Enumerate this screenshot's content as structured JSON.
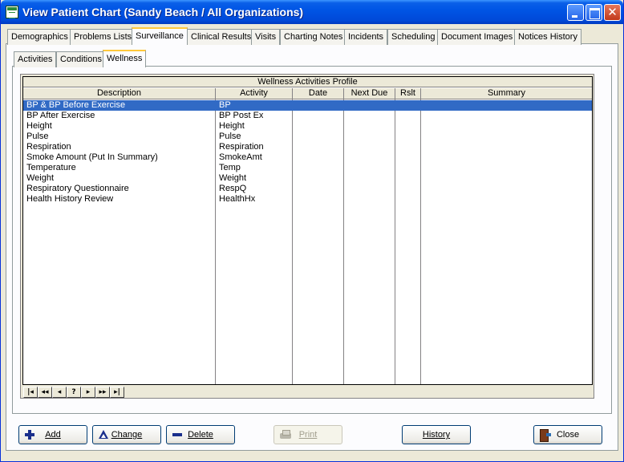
{
  "window": {
    "title": "View Patient Chart (Sandy Beach / All Organizations)",
    "close_glyph": "✕"
  },
  "main_tabs": [
    {
      "label": "Demographics"
    },
    {
      "label": "Problems Lists"
    },
    {
      "label": "Surveillance"
    },
    {
      "label": "Clinical Results"
    },
    {
      "label": "Visits"
    },
    {
      "label": "Charting Notes"
    },
    {
      "label": "Incidents"
    },
    {
      "label": "Scheduling"
    },
    {
      "label": "Document Images"
    },
    {
      "label": "Notices History"
    }
  ],
  "sub_tabs": [
    {
      "label": "Activities"
    },
    {
      "label": "Conditions"
    },
    {
      "label": "Wellness"
    }
  ],
  "grid": {
    "title": "Wellness Activities Profile",
    "columns": [
      "Description",
      "Activity",
      "Date",
      "Next Due",
      "Rslt",
      "Summary"
    ],
    "rows": [
      {
        "description": "BP & BP  Before Exercise",
        "activity": "BP",
        "date": "",
        "next_due": "",
        "rslt": "",
        "summary": ""
      },
      {
        "description": "BP After Exercise",
        "activity": "BP Post Ex",
        "date": "",
        "next_due": "",
        "rslt": "",
        "summary": ""
      },
      {
        "description": "Height",
        "activity": "Height",
        "date": "",
        "next_due": "",
        "rslt": "",
        "summary": ""
      },
      {
        "description": "Pulse",
        "activity": "Pulse",
        "date": "",
        "next_due": "",
        "rslt": "",
        "summary": ""
      },
      {
        "description": "Respiration",
        "activity": "Respiration",
        "date": "",
        "next_due": "",
        "rslt": "",
        "summary": ""
      },
      {
        "description": "Smoke Amount (Put In Summary)",
        "activity": "SmokeAmt",
        "date": "",
        "next_due": "",
        "rslt": "",
        "summary": ""
      },
      {
        "description": "Temperature",
        "activity": "Temp",
        "date": "",
        "next_due": "",
        "rslt": "",
        "summary": ""
      },
      {
        "description": "Weight",
        "activity": "Weight",
        "date": "",
        "next_due": "",
        "rslt": "",
        "summary": ""
      },
      {
        "description": "Respiratory Questionnaire",
        "activity": "RespQ",
        "date": "",
        "next_due": "",
        "rslt": "",
        "summary": ""
      },
      {
        "description": "Health History Review",
        "activity": "HealthHx",
        "date": "",
        "next_due": "",
        "rslt": "",
        "summary": ""
      }
    ]
  },
  "navigator": [
    {
      "name": "first-record",
      "glyph": "|◂"
    },
    {
      "name": "prior-page",
      "glyph": "◂◂"
    },
    {
      "name": "prior-record",
      "glyph": "◂"
    },
    {
      "name": "help",
      "glyph": "?"
    },
    {
      "name": "next-record",
      "glyph": "▸"
    },
    {
      "name": "next-page",
      "glyph": "▸▸"
    },
    {
      "name": "last-record",
      "glyph": "▸|"
    }
  ],
  "buttons": {
    "add": "Add",
    "change": "Change",
    "delete": "Delete",
    "print": "Print",
    "history": "History",
    "close": "Close"
  },
  "icons": {
    "add": "plus-icon",
    "change": "triangle-icon",
    "delete": "minus-icon",
    "print": "printer-icon",
    "close": "door-icon"
  },
  "colors": {
    "titlebar": "#0055E5",
    "selection": "#316AC5",
    "active_tab_accent": "#FFC83C",
    "window_bg": "#ECE9D8"
  }
}
